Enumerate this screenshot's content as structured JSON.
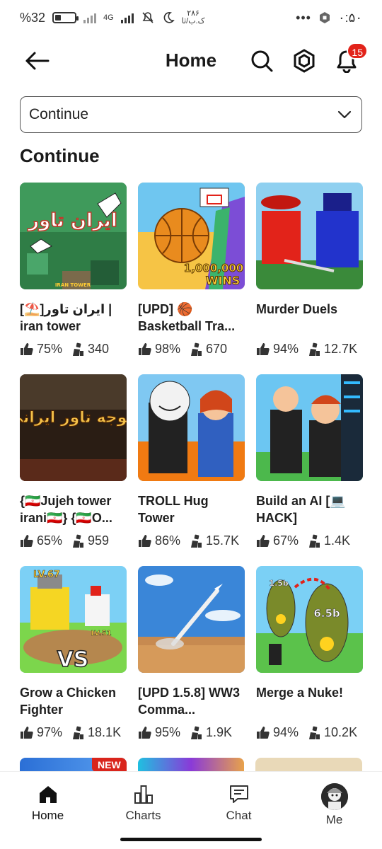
{
  "status_bar": {
    "battery_level": "%32",
    "battery_fraction": 0.32,
    "network": "4G",
    "date_small_top": "۲۸۶",
    "date_small_bottom": "ک.ب/ثا",
    "time": "۰:۵۰",
    "more": "•••"
  },
  "header": {
    "title": "Home",
    "notification_count": "15"
  },
  "filter": {
    "selected": "Continue"
  },
  "section_title": "Continue",
  "games": [
    {
      "name": "[⛱️]ایران تاور | iran tower",
      "rating": "75%",
      "players": "340"
    },
    {
      "name": "[UPD] 🏀 Basketball Tra...",
      "rating": "98%",
      "players": "670"
    },
    {
      "name": "Murder Duels",
      "rating": "94%",
      "players": "12.7K"
    },
    {
      "name": "{🇮🇷Jujeh tower irani🇮🇷} {🇮🇷O...",
      "rating": "65%",
      "players": "959"
    },
    {
      "name": "TROLL Hug Tower",
      "rating": "86%",
      "players": "15.7K"
    },
    {
      "name": "Build an AI [💻 HACK]",
      "rating": "67%",
      "players": "1.4K"
    },
    {
      "name": "Grow a Chicken Fighter",
      "rating": "97%",
      "players": "18.1K"
    },
    {
      "name": "[UPD 1.5.8] WW3 Comma...",
      "rating": "95%",
      "players": "1.9K"
    },
    {
      "name": "Merge a Nuke!",
      "rating": "94%",
      "players": "10.2K"
    }
  ],
  "thumb_text": {
    "g0": "ایران تاور",
    "g0_small": "IRAN TOWER",
    "g1": "1,000,000",
    "g1b": "WINS",
    "g3": "جوجه تاور ایرانی",
    "g6_top": "LV.67",
    "g6_mid": "LV.51",
    "g6_vs": "VS",
    "g8_a": "1.5b",
    "g8_b": "6.5b"
  },
  "partial_tag": "NEW",
  "nav": [
    {
      "label": "Home",
      "icon": "home-icon"
    },
    {
      "label": "Charts",
      "icon": "charts-icon"
    },
    {
      "label": "Chat",
      "icon": "chat-icon"
    },
    {
      "label": "Me",
      "icon": "avatar-icon"
    }
  ]
}
